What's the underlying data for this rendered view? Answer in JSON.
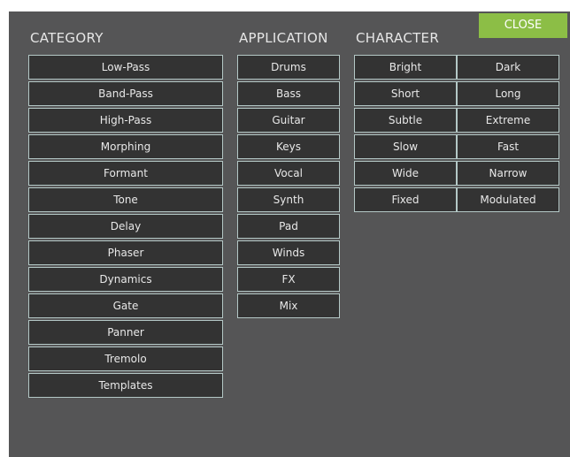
{
  "headings": {
    "category": "CATEGORY",
    "application": "APPLICATION",
    "character": "CHARACTER"
  },
  "close_label": "CLOSE",
  "colors": {
    "panel": "#555556",
    "button_bg": "#333333",
    "button_border": "#b4c8c6",
    "close_bg": "#8cbe46"
  },
  "category": [
    "Low-Pass",
    "Band-Pass",
    "High-Pass",
    "Morphing",
    "Formant",
    "Tone",
    "Delay",
    "Phaser",
    "Dynamics",
    "Gate",
    "Panner",
    "Tremolo",
    "Templates"
  ],
  "application": [
    "Drums",
    "Bass",
    "Guitar",
    "Keys",
    "Vocal",
    "Synth",
    "Pad",
    "Winds",
    "FX",
    "Mix"
  ],
  "character": [
    "Bright",
    "Dark",
    "Short",
    "Long",
    "Subtle",
    "Extreme",
    "Slow",
    "Fast",
    "Wide",
    "Narrow",
    "Fixed",
    "Modulated"
  ]
}
